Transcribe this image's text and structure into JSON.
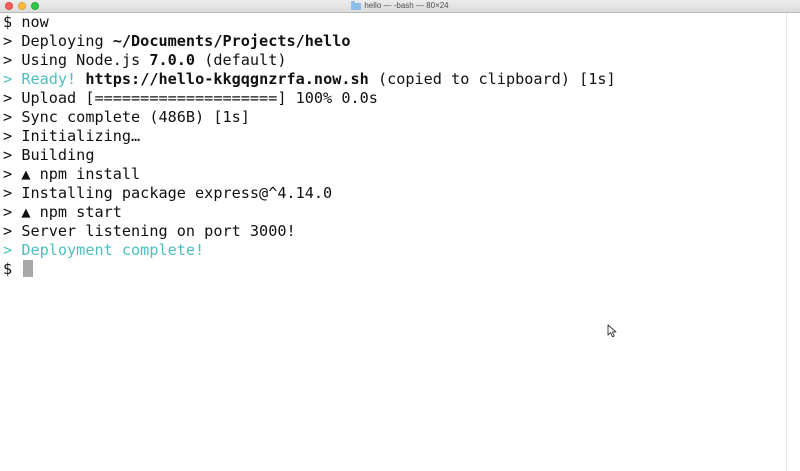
{
  "window": {
    "title": "hello — -bash — 80×24"
  },
  "terminal": {
    "lines": [
      {
        "prompt": "$",
        "parts": [
          {
            "text": "now",
            "style": "normal"
          }
        ]
      },
      {
        "prompt": ">",
        "parts": [
          {
            "text": "Deploying ",
            "style": "normal"
          },
          {
            "text": "~/Documents/Projects/hello",
            "style": "bold"
          }
        ]
      },
      {
        "prompt": ">",
        "parts": [
          {
            "text": "Using Node.js ",
            "style": "normal"
          },
          {
            "text": "7.0.0",
            "style": "bold"
          },
          {
            "text": " (default)",
            "style": "normal"
          }
        ]
      },
      {
        "prompt": ">",
        "parts": [
          {
            "text": "Ready!",
            "style": "ready"
          },
          {
            "text": " ",
            "style": "normal"
          },
          {
            "text": "https://hello-kkgqgnzrfa.now.sh",
            "style": "bold"
          },
          {
            "text": " (copied to clipboard) [1s]",
            "style": "normal"
          }
        ]
      },
      {
        "prompt": ">",
        "parts": [
          {
            "text": "Upload [====================] 100% 0.0s",
            "style": "normal"
          }
        ]
      },
      {
        "prompt": ">",
        "parts": [
          {
            "text": "Sync complete (486B) [1s]",
            "style": "normal"
          }
        ]
      },
      {
        "prompt": ">",
        "parts": [
          {
            "text": "Initializing…",
            "style": "normal"
          }
        ]
      },
      {
        "prompt": ">",
        "parts": [
          {
            "text": "Building",
            "style": "normal"
          }
        ]
      },
      {
        "prompt": ">",
        "parts": [
          {
            "text": "▲ npm install",
            "style": "normal"
          }
        ]
      },
      {
        "prompt": ">",
        "parts": [
          {
            "text": "Installing package express@^4.14.0",
            "style": "normal"
          }
        ]
      },
      {
        "prompt": ">",
        "parts": [
          {
            "text": "▲ npm start",
            "style": "normal"
          }
        ]
      },
      {
        "prompt": ">",
        "parts": [
          {
            "text": "Server listening on port 3000!",
            "style": "normal"
          }
        ]
      },
      {
        "prompt": ">",
        "parts": [
          {
            "text": "Deployment complete!",
            "style": "complete"
          }
        ]
      }
    ],
    "final_prompt": "$"
  },
  "colors": {
    "accent_cyan": "#4dbfbf",
    "text": "#111111",
    "cursor": "#a8a8a8"
  }
}
